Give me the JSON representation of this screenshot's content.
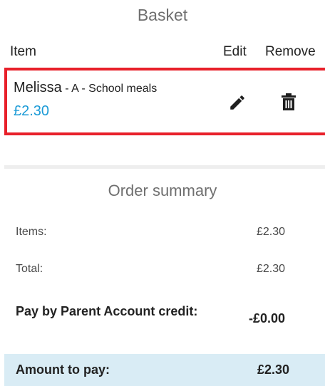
{
  "basket": {
    "title": "Basket",
    "headers": {
      "item": "Item",
      "edit": "Edit",
      "remove": "Remove"
    },
    "items": [
      {
        "child": "Melissa",
        "details": " - A - School meals",
        "price": "£2.30",
        "edit_icon": "pencil-icon",
        "remove_icon": "trash-icon"
      }
    ]
  },
  "summary": {
    "title": "Order summary",
    "items_label": "Items:",
    "items_value": "£2.30",
    "total_label": "Total:",
    "total_value": "£2.30",
    "credit_label": "Pay by Parent Account credit:",
    "credit_value": "-£0.00",
    "pay_label": "Amount to pay:",
    "pay_value": "£2.30"
  },
  "colors": {
    "highlight_border": "#e8202a",
    "price": "#1a9ad6",
    "pay_row_bg": "#d9ecf5"
  }
}
